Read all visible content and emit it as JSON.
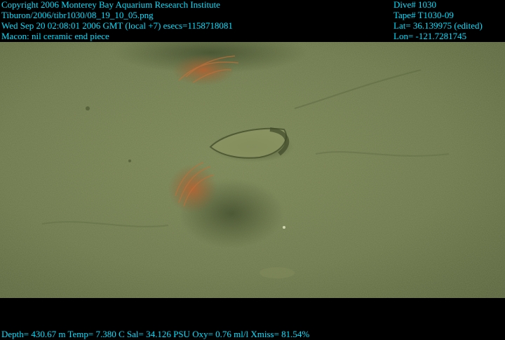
{
  "header": {
    "left_lines": [
      "Copyright 2006 Monterey Bay Aquarium Research Institute",
      "Tiburon/2006/tibr1030/08_19_10_05.png",
      "Wed Sep 20 02:08:01 2006 GMT (local +7)  esecs=1158718081",
      "Macon: nil ceramic end piece"
    ],
    "right_lines": [
      "Dive# 1030",
      "Tape# T1030-09",
      "Lat= 36.139975 (edited)",
      "Lon= -121.7281745"
    ]
  },
  "footer": {
    "sensor_line": "Depth= 430.67 m  Temp= 7.380 C  Sal= 34.126 PSU  Oxy= 0.76 ml/l  Xmiss= 81.54%"
  },
  "colors": {
    "overlay_text": "#00e0ff",
    "seafloor": "#6e7a4e",
    "background": "#000000"
  }
}
